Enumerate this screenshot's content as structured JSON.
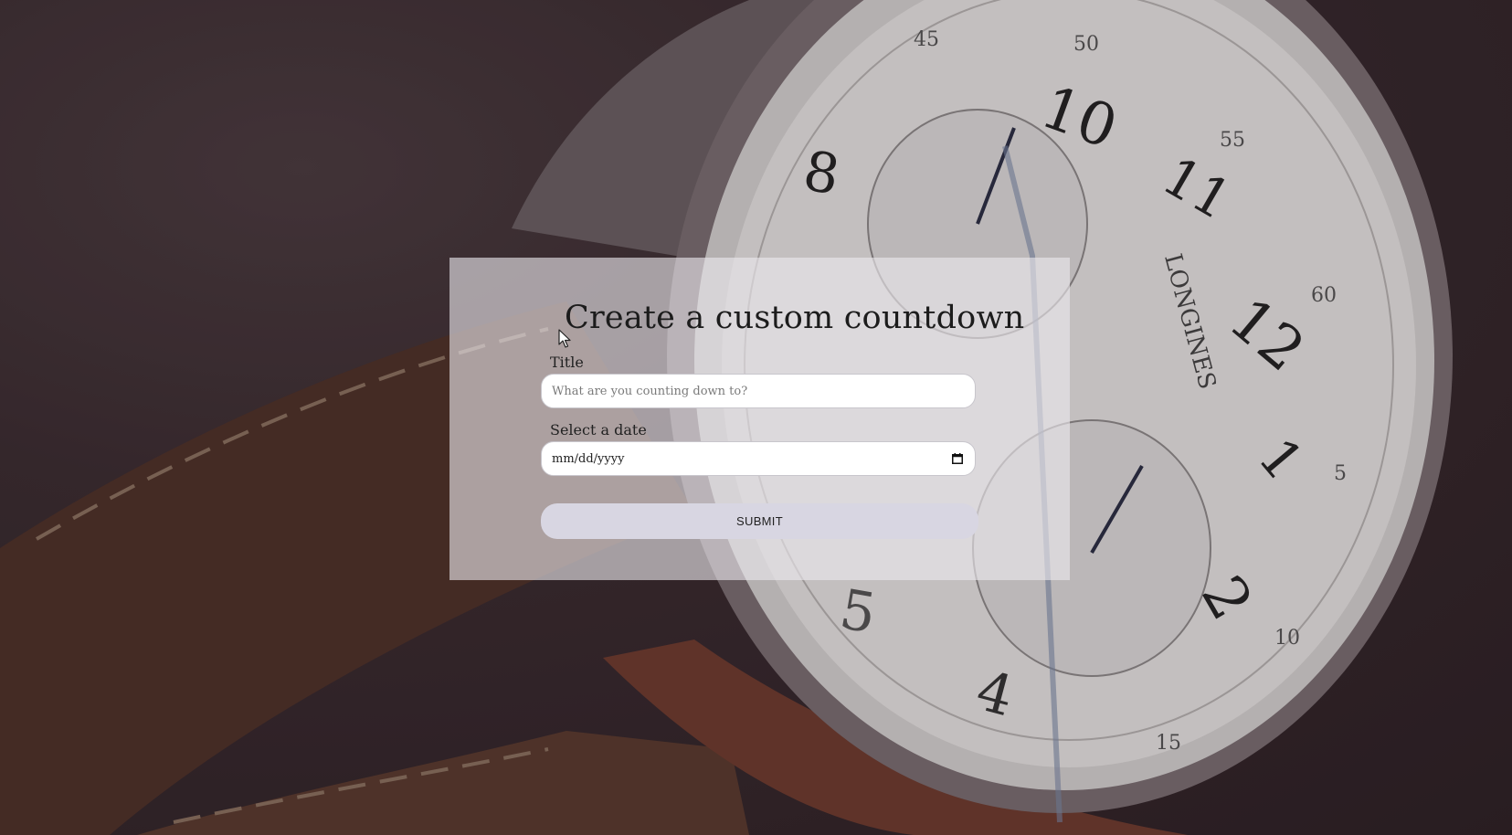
{
  "form": {
    "heading": "Create a custom countdown",
    "title_label": "Title",
    "title_placeholder": "What are you counting down to?",
    "date_label": "Select a date",
    "date_value": "mm/dd/yyyy",
    "submit_label": "SUBMIT"
  },
  "background": {
    "brand": "LONGINES",
    "colors": {
      "backdrop": "#2c2024",
      "strap": "#5a3a2e",
      "dial": "#e8e6e4",
      "panel": "#ece8ee",
      "button": "#d8d6e2"
    }
  },
  "icons": {
    "calendar": "calendar-icon",
    "cursor": "mouse-pointer-icon"
  }
}
